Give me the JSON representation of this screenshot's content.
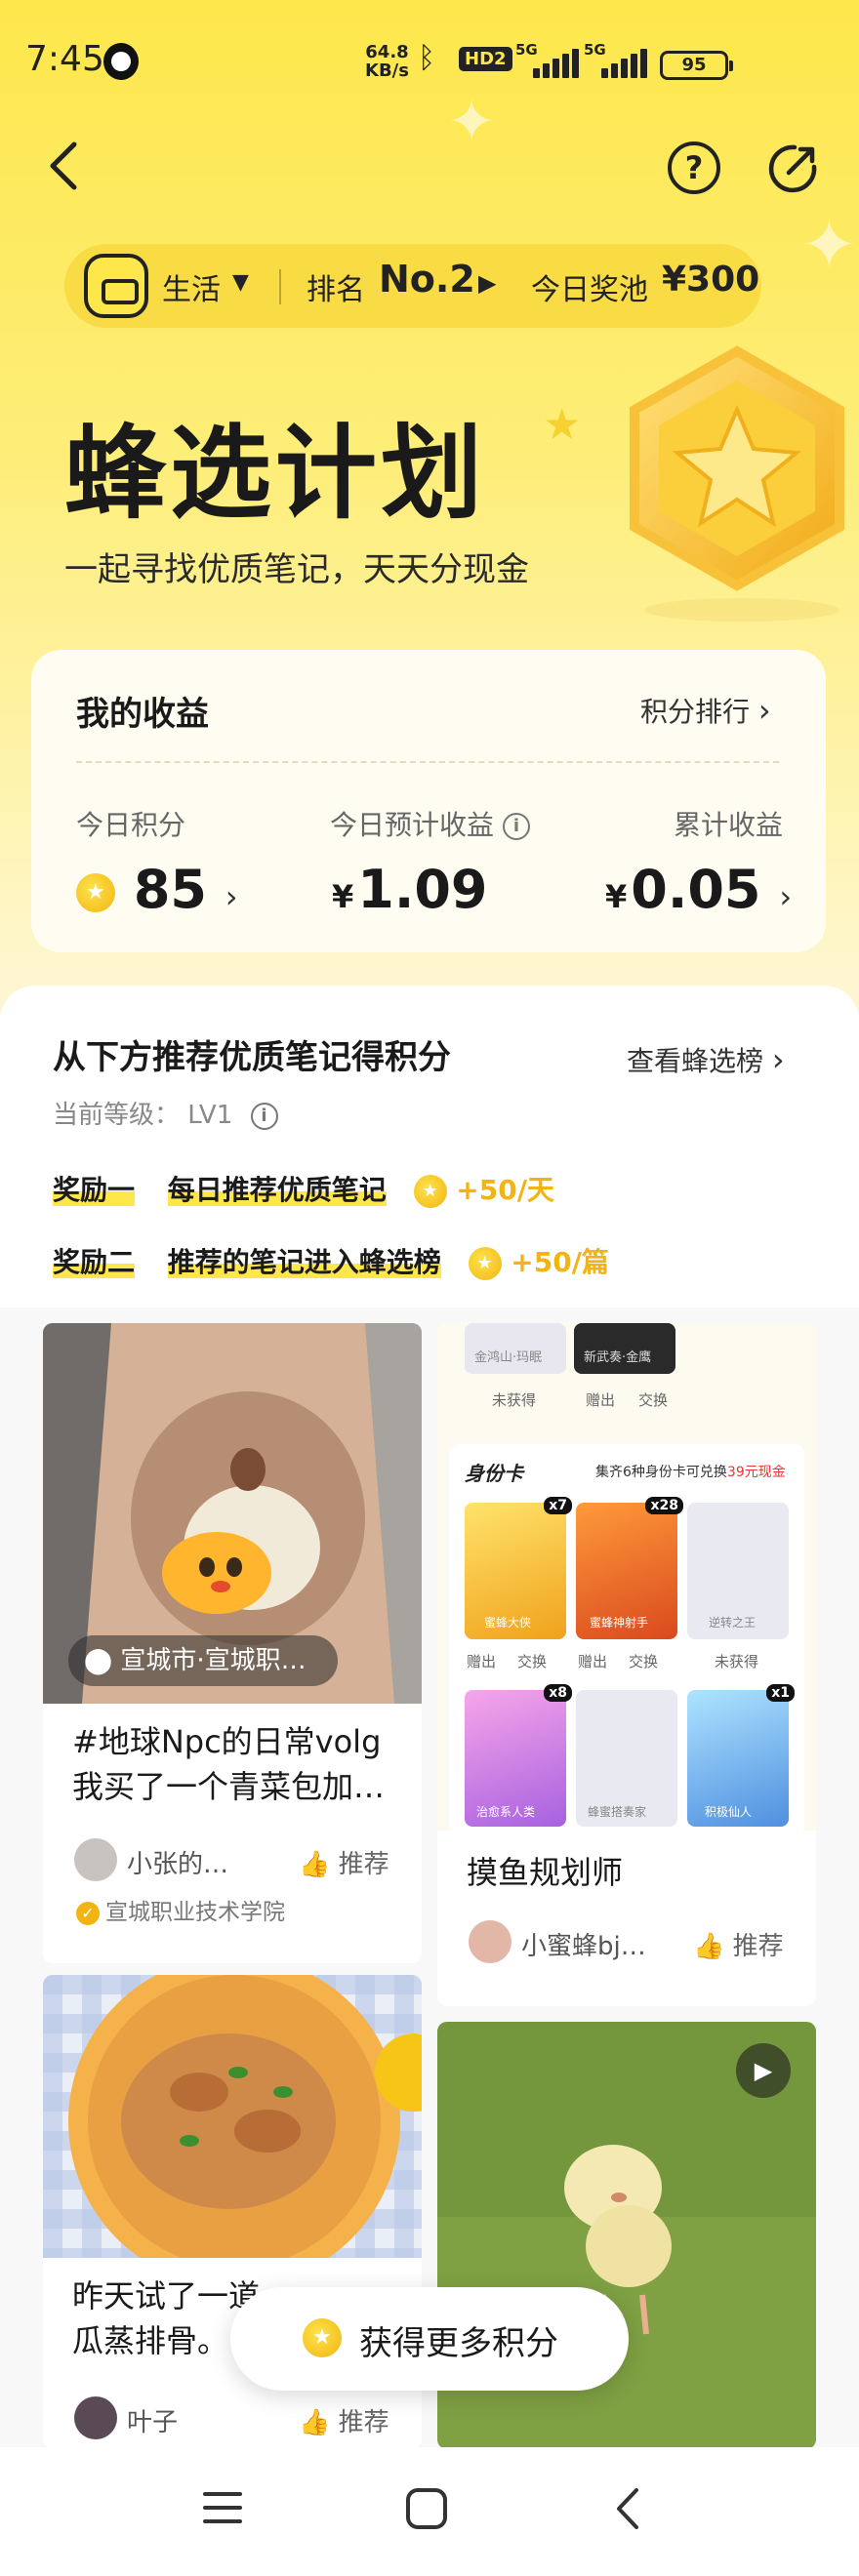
{
  "status_bar": {
    "time": "7:45",
    "speed_value": "64.8",
    "speed_unit": "KB/s",
    "hd": "HD2",
    "net1": "5G",
    "net2": "5G",
    "battery": "95"
  },
  "nav": {
    "back_icon": "chevron-left-icon",
    "help_icon": "question-icon",
    "share_icon": "share-icon"
  },
  "category_bar": {
    "category": "生活",
    "rank_label": "排名",
    "rank_value": "No.2",
    "pool_label": "今日奖池",
    "pool_value": "¥300"
  },
  "hero": {
    "title": "蜂选计划",
    "subtitle": "一起寻找优质笔记，天天分现金"
  },
  "earnings": {
    "title": "我的收益",
    "rank_link": "积分排行",
    "points_label": "今日积分",
    "points_value": "85",
    "estimated_label": "今日预计收益",
    "estimated_value": "1.09",
    "total_label": "累计收益",
    "total_value": "0.05",
    "currency": "¥"
  },
  "recommend": {
    "title": "从下方推荐优质笔记得积分",
    "list_link": "查看蜂选榜",
    "level_label": "当前等级：",
    "level_value": "LV1",
    "rewards": [
      {
        "label": "奖励一",
        "desc": "每日推荐优质笔记",
        "bonus": "+50/天"
      },
      {
        "label": "奖励二",
        "desc": "推荐的笔记进入蜂选榜",
        "bonus": "+50/篇"
      }
    ]
  },
  "notes": [
    {
      "location": "宣城市·宣城职…",
      "title_line1": "#地球Npc的日常volg",
      "title_line2": "我买了一个青菜包加…",
      "author": "小张的…",
      "like_label": "推荐",
      "school": "宣城职业技术学院"
    },
    {
      "title": "摸鱼规划师",
      "author": "小蜜蜂bj…",
      "like_label": "推荐",
      "id_cards": {
        "top_caps": [
          "未获得",
          "赠出",
          "交换"
        ],
        "top_card_texts": [
          "金鸿山·玛眠",
          "新武奏·金鹰"
        ],
        "header": "身份卡",
        "promo_prefix": "集齐6种身份卡可兑换",
        "promo_cash": "39元现金",
        "row1": [
          {
            "name": "蜜蜂大侠",
            "badge": "x7"
          },
          {
            "name": "蜜蜂神射手",
            "badge": "x28"
          },
          {
            "name": "逆转之王",
            "badge": ""
          }
        ],
        "row1_caps": [
          "赠出",
          "交换",
          "赠出",
          "交换",
          "未获得"
        ],
        "row2": [
          {
            "name": "治愈系人类",
            "badge": "x8"
          },
          {
            "name": "蜂蜜搭奏家",
            "badge": ""
          },
          {
            "name": "积极仙人",
            "badge": "x1"
          }
        ]
      }
    },
    {
      "title_line1": "昨天试了一道",
      "title_line2": "瓜蒸排骨。",
      "author": "叶子",
      "like_label": "推荐"
    },
    {
      "video_icon": "play-icon"
    }
  ],
  "float_button": {
    "label": "获得更多积分"
  },
  "system_nav": {
    "menu_icon": "menu-icon",
    "home_icon": "home-icon",
    "back_icon": "back-icon"
  },
  "colors": {
    "brand_yellow": "#fde74b",
    "gold": "#f2b412"
  }
}
